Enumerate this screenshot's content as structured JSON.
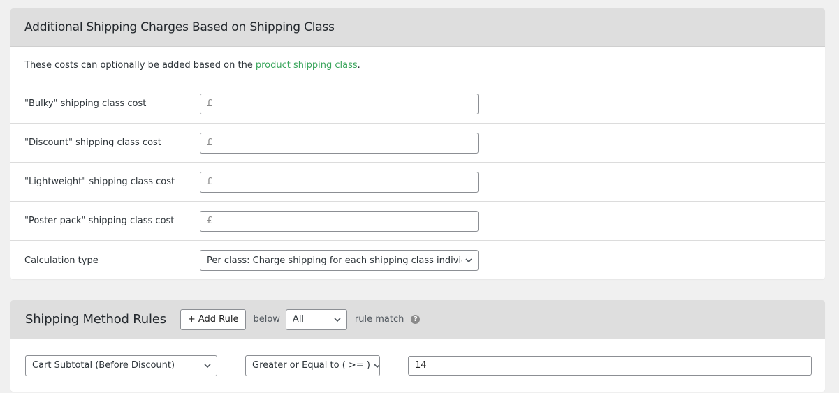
{
  "section1": {
    "title": "Additional Shipping Charges Based on Shipping Class",
    "description_prefix": "These costs can optionally be added based on the",
    "description_link": "product shipping class",
    "description_suffix": ".",
    "link_color": "#3aa55c",
    "fields": [
      {
        "label": "\"Bulky\" shipping class cost",
        "placeholder": "£",
        "value": ""
      },
      {
        "label": "\"Discount\" shipping class cost",
        "placeholder": "£",
        "value": ""
      },
      {
        "label": "\"Lightweight\" shipping class cost",
        "placeholder": "£",
        "value": ""
      },
      {
        "label": "\"Poster pack\" shipping class cost",
        "placeholder": "£",
        "value": ""
      }
    ],
    "calculation_type": {
      "label": "Calculation type",
      "selected": "Per class: Charge shipping for each shipping class individually"
    }
  },
  "section2": {
    "title": "Shipping Method Rules",
    "add_rule_label": "+ Add Rule",
    "below_label": "below",
    "match_select": "All",
    "rule_match_label": "rule match",
    "help_icon": "?",
    "rules": [
      {
        "condition": "Cart Subtotal (Before Discount)",
        "operator": "Greater or Equal to ( >= )",
        "value": "14"
      }
    ]
  }
}
